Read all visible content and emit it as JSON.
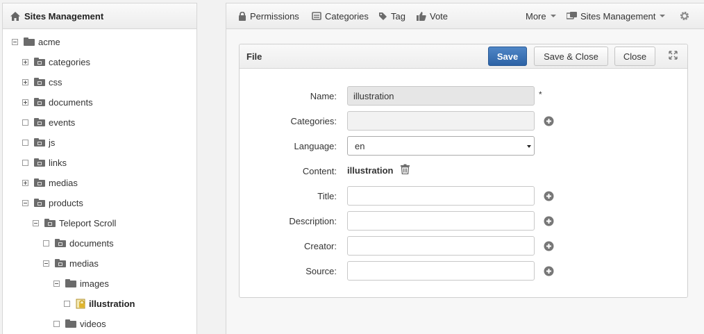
{
  "left_panel": {
    "title": "Sites Management",
    "tree": [
      {
        "label": "acme",
        "toggle": "minus",
        "icon": "folder-icon"
      },
      {
        "label": "categories",
        "toggle": "plus",
        "icon": "folder-categories-icon"
      },
      {
        "label": "css",
        "toggle": "plus",
        "icon": "folder-css-icon"
      },
      {
        "label": "documents",
        "toggle": "plus",
        "icon": "folder-documents-icon"
      },
      {
        "label": "events",
        "toggle": "none",
        "icon": "folder-events-icon"
      },
      {
        "label": "js",
        "toggle": "none",
        "icon": "folder-js-icon"
      },
      {
        "label": "links",
        "toggle": "none",
        "icon": "folder-links-icon"
      },
      {
        "label": "medias",
        "toggle": "plus",
        "icon": "folder-medias-icon"
      },
      {
        "label": "products",
        "toggle": "minus",
        "icon": "folder-products-icon"
      },
      {
        "label": "Teleport Scroll",
        "toggle": "minus",
        "icon": "folder-product-icon"
      },
      {
        "label": "documents",
        "toggle": "none",
        "icon": "folder-documents-icon"
      },
      {
        "label": "medias",
        "toggle": "minus",
        "icon": "folder-medias-icon"
      },
      {
        "label": "images",
        "toggle": "minus",
        "icon": "folder-icon"
      },
      {
        "label": "illustration",
        "toggle": "none",
        "icon": "locked-file-icon",
        "selected": true
      },
      {
        "label": "videos",
        "toggle": "none",
        "icon": "folder-icon"
      }
    ]
  },
  "toolbar": {
    "permissions": "Permissions",
    "categories": "Categories",
    "tag": "Tag",
    "vote": "Vote",
    "more": "More",
    "sites_management": "Sites Management"
  },
  "form": {
    "title": "File",
    "save": "Save",
    "save_close": "Save & Close",
    "close": "Close",
    "fields": {
      "name_label": "Name:",
      "name_value": "illustration",
      "required_mark": "*",
      "categories_label": "Categories:",
      "language_label": "Language:",
      "language_value": "en",
      "content_label": "Content:",
      "content_value": "illustration",
      "title_label": "Title:",
      "description_label": "Description:",
      "creator_label": "Creator:",
      "source_label": "Source:"
    }
  },
  "colors": {
    "primary": "#3a6fb2",
    "icon_gray": "#6b6b6b"
  }
}
